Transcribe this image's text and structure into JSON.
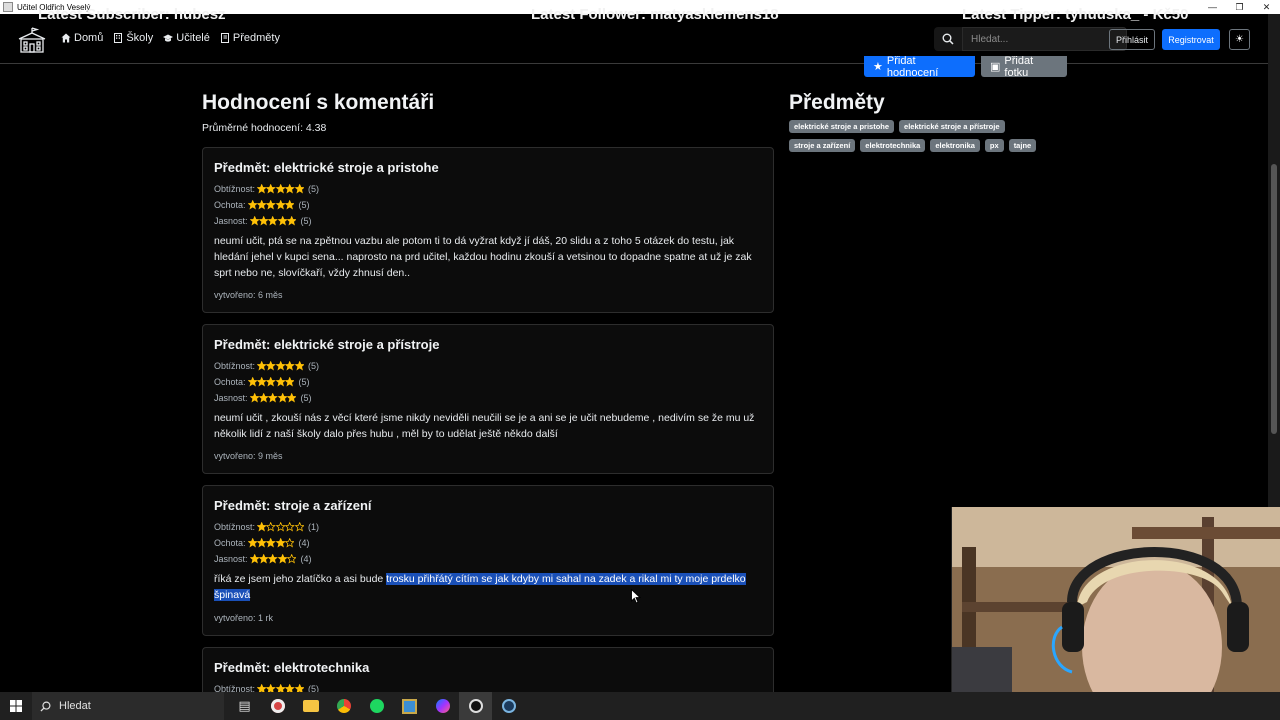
{
  "window": {
    "title": "Učitel Oldřich Veselý"
  },
  "stream_overlay": {
    "subscriber": "Latest Subscriber: hubesz",
    "follower": "Latest Follower: matyasklemens18",
    "tipper": "Latest Tipper: tyhuuska_ - Kč50"
  },
  "navbar": {
    "links": [
      "Domů",
      "Školy",
      "Učitelé",
      "Předměty"
    ],
    "search_placeholder": "Hledat...",
    "login": "Přihlásit",
    "register": "Registrovat",
    "theme_icon": "sun-icon"
  },
  "actions": {
    "add_rating": "Přidat hodnocení",
    "add_photo": "Přidat fotku"
  },
  "main": {
    "title": "Hodnocení s komentáři",
    "average": "Průměrné hodnocení: 4.38",
    "labels": {
      "difficulty": "Obtížnost:",
      "willingness": "Ochota:",
      "clarity": "Jasnost:"
    },
    "reviews": [
      {
        "subject": "Předmět: elektrické stroje a pristohe",
        "difficulty": 5,
        "difficulty_text": "(5)",
        "willingness": 5,
        "willingness_text": "(5)",
        "clarity": 5,
        "clarity_text": "(5)",
        "comment": "neumí učit, ptá se na zpětnou vazbu ale potom ti to dá vyžrat když jí dáš, 20 slidu a z toho 5 otázek do testu, jak hledání jehel v kupci sena... naprosto na prd učitel, každou hodinu zkouší a vetsinou to dopadne spatne at už je zak sprt nebo ne, slovíčkaří, vždy zhnusí den..",
        "created": "vytvořeno: 6 měs"
      },
      {
        "subject": "Předmět: elektrické stroje a přístroje",
        "difficulty": 5,
        "difficulty_text": "(5)",
        "willingness": 5,
        "willingness_text": "(5)",
        "clarity": 5,
        "clarity_text": "(5)",
        "comment": "neumí učit , zkouší nás z věcí které jsme nikdy neviděli neučili se je a ani se je učit nebudeme , nedivím se že mu už několik lidí z naší školy dalo přes hubu , měl by to udělat ještě někdo další",
        "created": "vytvořeno: 9 měs"
      },
      {
        "subject": "Předmět: stroje a zařízení",
        "difficulty": 1,
        "difficulty_text": "(1)",
        "willingness": 4,
        "willingness_text": "(4)",
        "clarity": 4,
        "clarity_text": "(4)",
        "comment_plain": "říká ze jsem jeho zlatíčko a asi bude ",
        "comment_selected": "trosku přihřátý cítím se jak kdyby mi sahal na zadek a rikal mi ty moje prdelko špinavá",
        "created": "vytvořeno: 1 rk"
      },
      {
        "subject": "Předmět: elektrotechnika",
        "difficulty": 5,
        "difficulty_text": "(5)"
      }
    ]
  },
  "sidebar": {
    "title": "Předměty",
    "tags": [
      "elektrické stroje a pristohe",
      "elektrické stroje a přístroje",
      "stroje a zařízení",
      "elektrotechnika",
      "elektronika",
      "px",
      "tajne"
    ]
  },
  "taskbar": {
    "search": "Hledat"
  },
  "colors": {
    "accent": "#0d6efd",
    "star": "#ffc107",
    "tag": "#6c757d",
    "selection": "#1a50b8"
  }
}
